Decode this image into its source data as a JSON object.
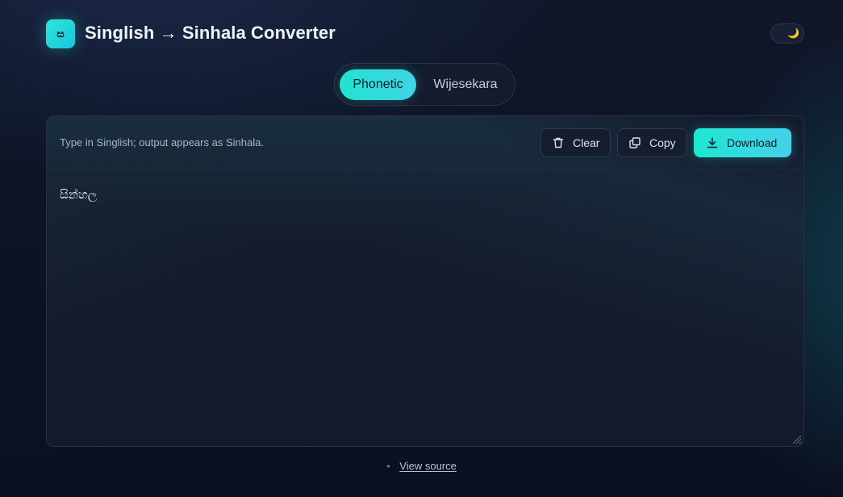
{
  "header": {
    "logo_glyph": "ස",
    "title": "Singlish → Sinhala Converter",
    "theme_toggle_icon": "moon-icon",
    "theme_toggle_glyph": "🌙"
  },
  "mode_tabs": [
    {
      "label": "Phonetic",
      "active": true
    },
    {
      "label": "Wijesekara",
      "active": false
    }
  ],
  "editor": {
    "hint": "Type in Singlish; output appears as Sinhala.",
    "actions": {
      "clear_label": "Clear",
      "copy_label": "Copy",
      "download_label": "Download"
    },
    "content": "සින්හල"
  },
  "footer": {
    "bullet": "•",
    "link_label": "View source"
  },
  "colors": {
    "accent": "#22e3cf",
    "background": "#0d1324",
    "card": "#141a2b"
  }
}
